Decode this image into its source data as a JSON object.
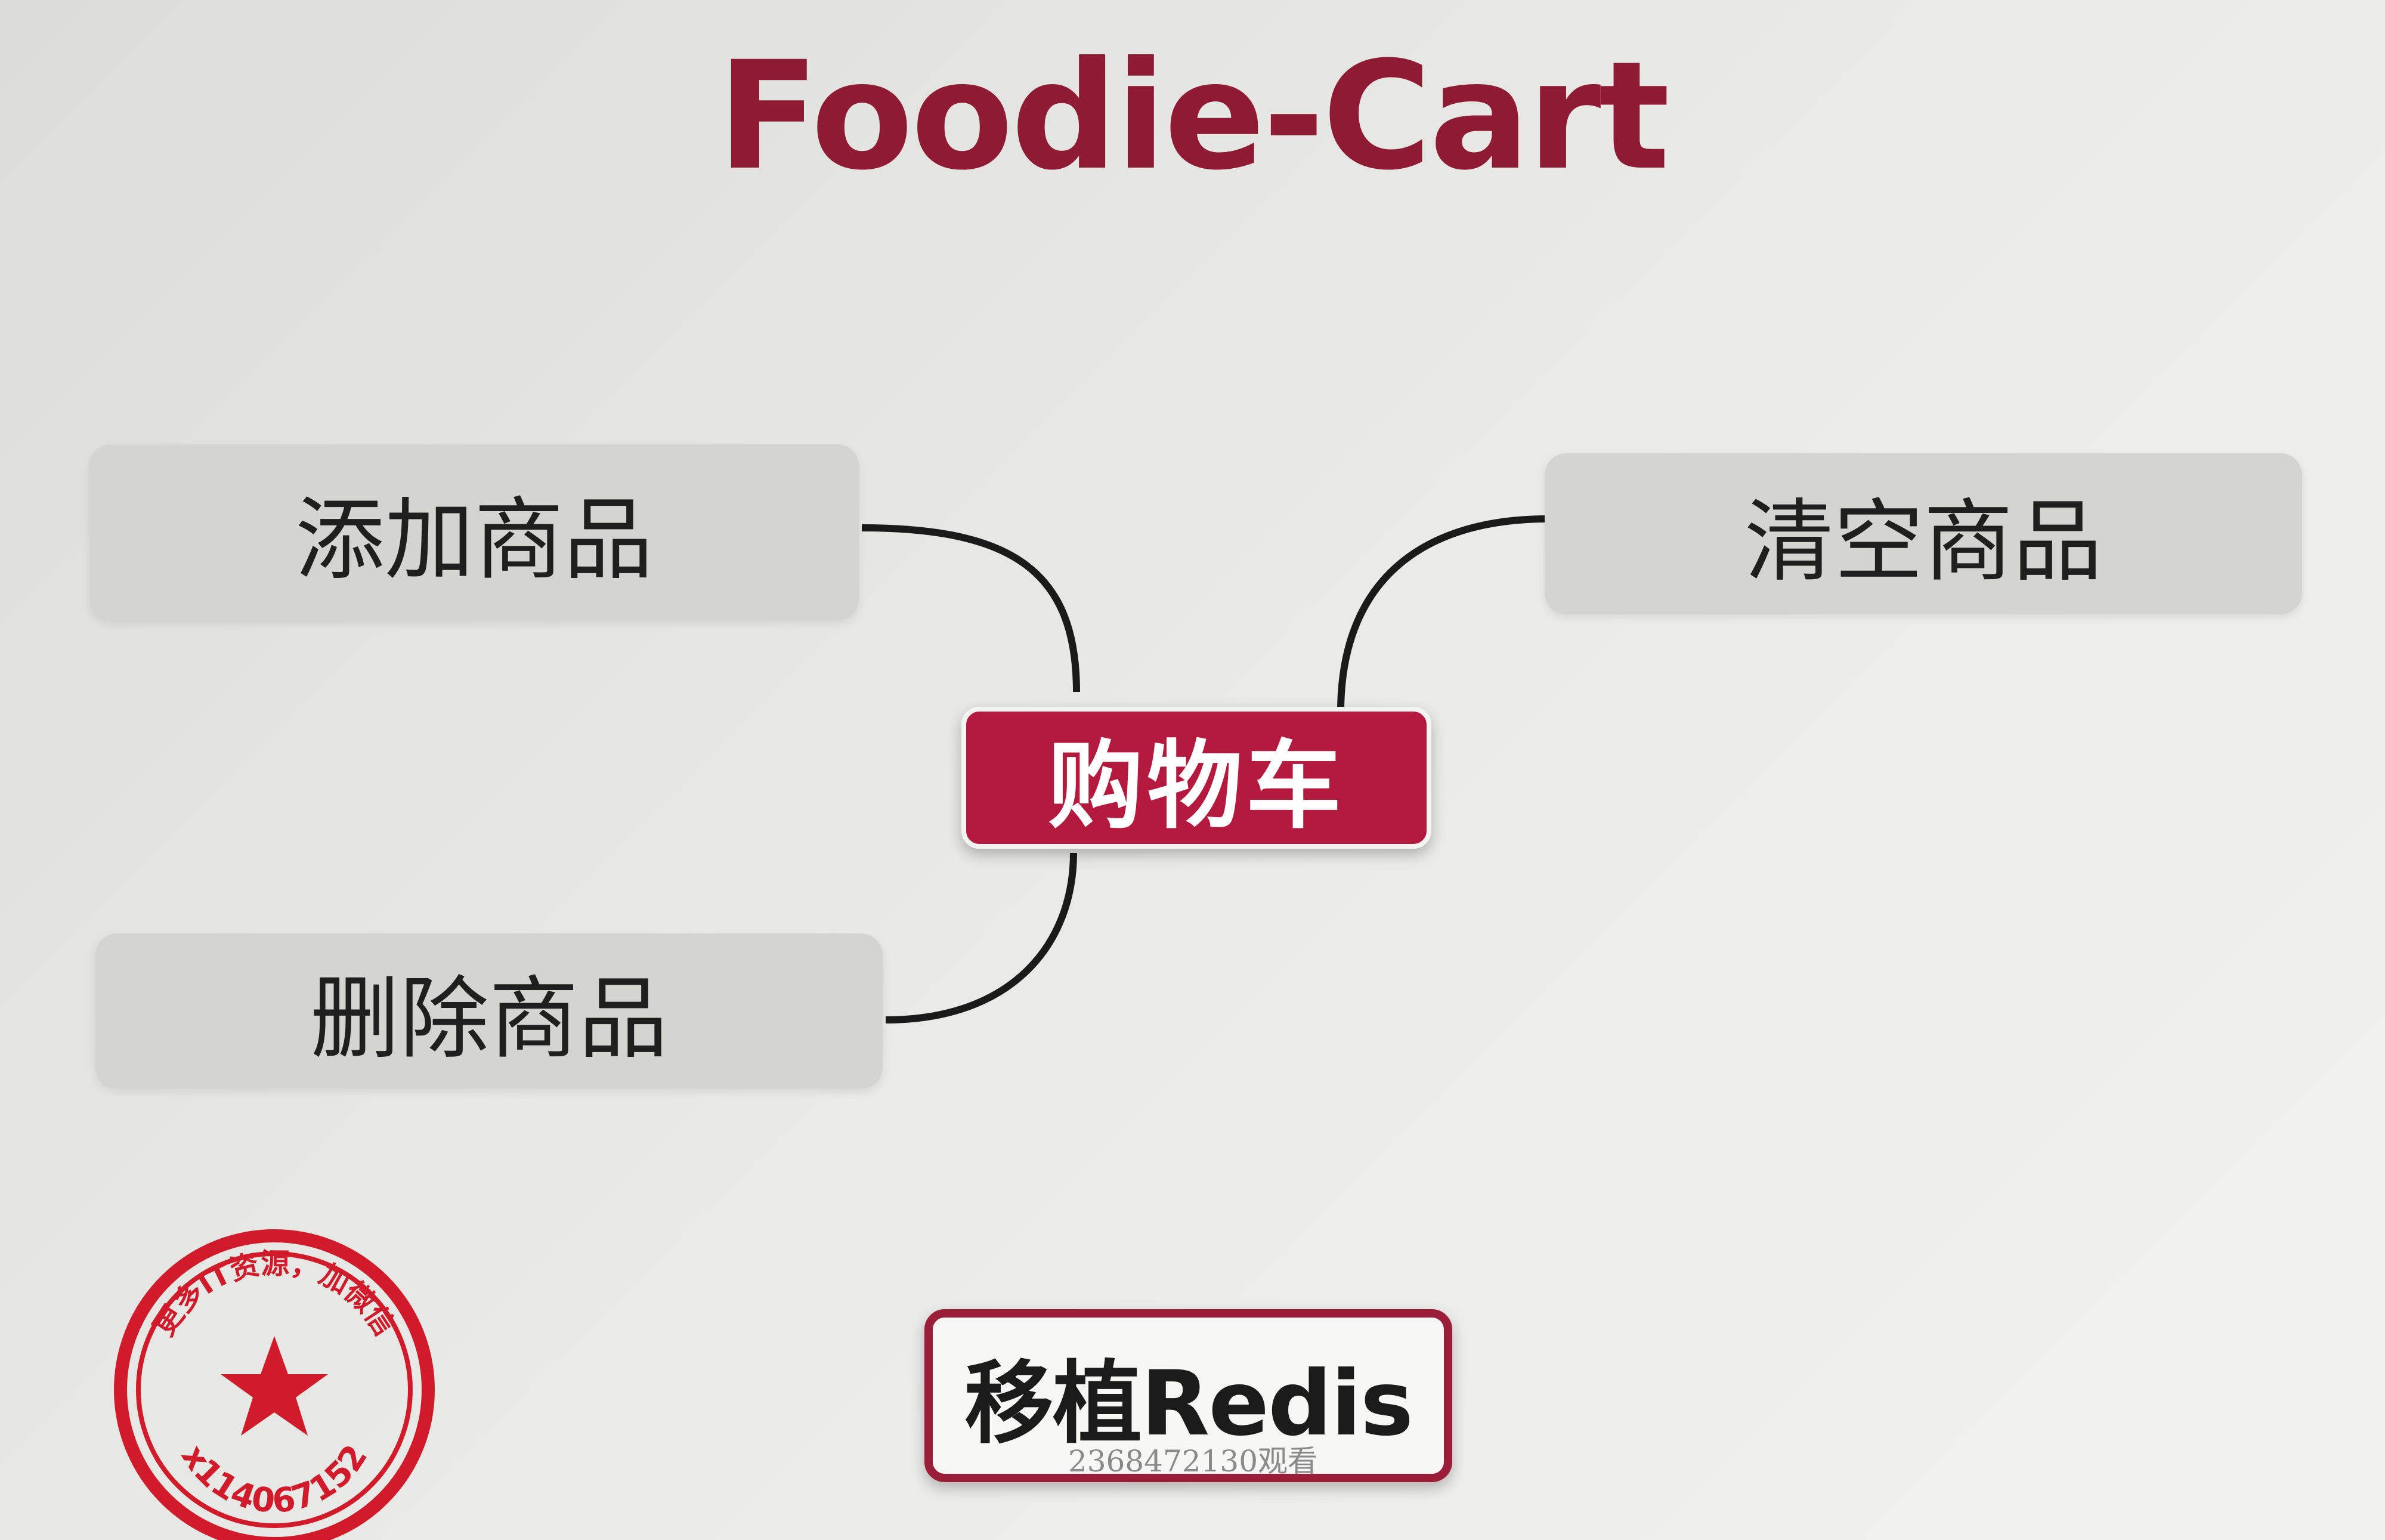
{
  "title": "Foodie-Cart",
  "center": {
    "label": "购物车"
  },
  "branches": {
    "add": "添加商品",
    "clear": "清空商品",
    "delete": "删除商品"
  },
  "action_button": {
    "label": "移植Redis"
  },
  "overlay_text": "2368472130观看",
  "seal": {
    "top_text": "更多IT资源，加微信",
    "bottom_text": "x114067152"
  },
  "colors": {
    "accent": "#8f1a33",
    "center_fill": "#b41a3e",
    "node_fill": "#d4d4d1",
    "seal_red": "#d11a2a"
  }
}
